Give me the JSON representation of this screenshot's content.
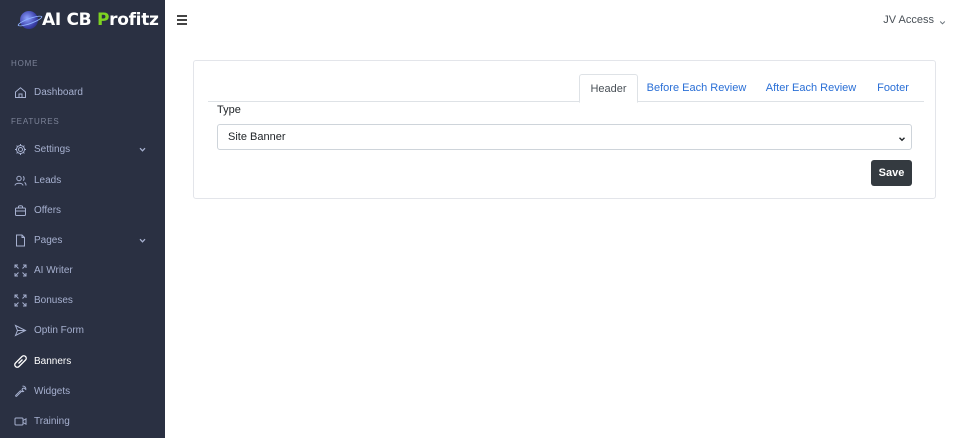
{
  "brand": {
    "part1": "AI CB ",
    "part2": "P",
    "part3": "rofitz"
  },
  "sidebar": {
    "sections": {
      "home": "HOME",
      "features": "FEATURES"
    },
    "items": [
      {
        "label": "Dashboard",
        "icon": "home-icon"
      },
      {
        "label": "Settings",
        "icon": "gear-icon",
        "has_submenu": true
      },
      {
        "label": "Leads",
        "icon": "users-icon"
      },
      {
        "label": "Offers",
        "icon": "bag-icon"
      },
      {
        "label": "Pages",
        "icon": "file-icon",
        "has_submenu": true
      },
      {
        "label": "AI Writer",
        "icon": "expand-icon"
      },
      {
        "label": "Bonuses",
        "icon": "expand-icon"
      },
      {
        "label": "Optin Form",
        "icon": "send-icon"
      },
      {
        "label": "Banners",
        "icon": "tag-icon",
        "active": true
      },
      {
        "label": "Widgets",
        "icon": "wrench-icon"
      },
      {
        "label": "Training",
        "icon": "video-icon"
      }
    ]
  },
  "topbar": {
    "user_label": "JV Access"
  },
  "tabs": [
    {
      "label": "Header",
      "active": true
    },
    {
      "label": "Before Each Review"
    },
    {
      "label": "After Each Review"
    },
    {
      "label": "Footer"
    }
  ],
  "form": {
    "type_label": "Type",
    "type_value": "Site Banner",
    "save_label": "Save"
  },
  "colors": {
    "sidebar_bg": "#2a3042",
    "link": "#2a6fd6",
    "button_bg": "#343a40",
    "brand_green": "#7ed321"
  }
}
